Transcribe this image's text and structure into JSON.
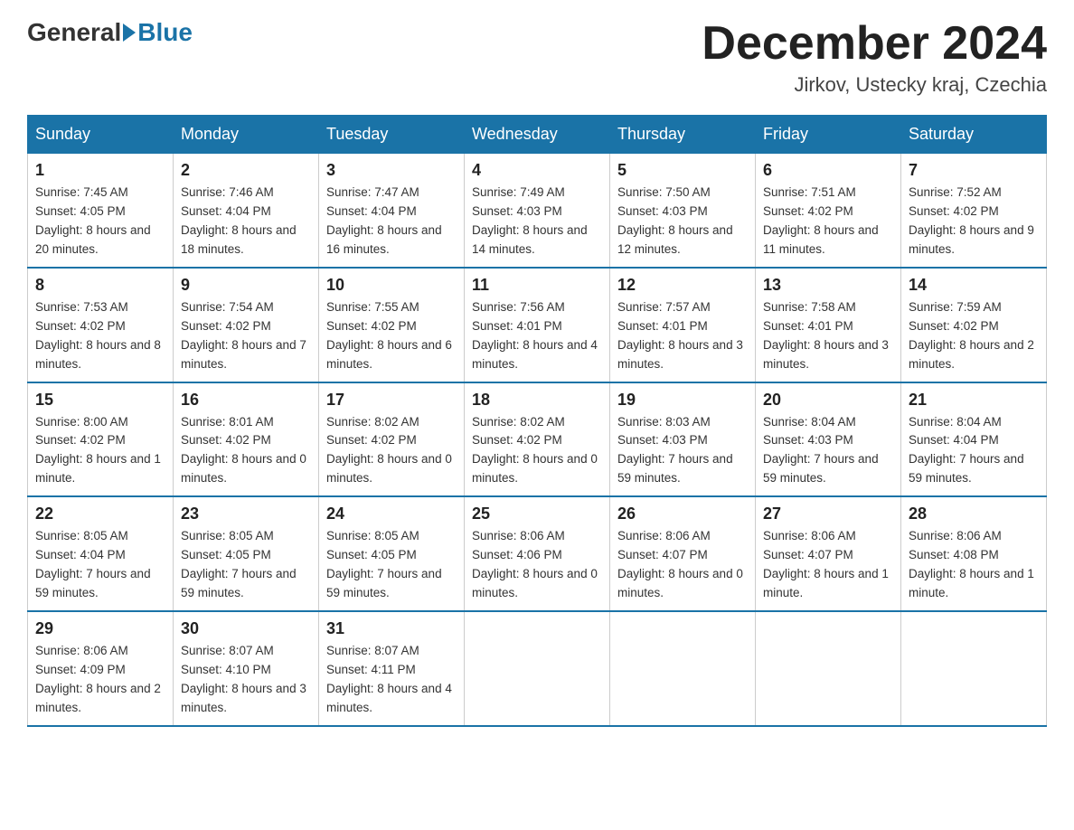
{
  "header": {
    "logo_general": "General",
    "logo_blue": "Blue",
    "title": "December 2024",
    "location": "Jirkov, Ustecky kraj, Czechia"
  },
  "weekdays": [
    "Sunday",
    "Monday",
    "Tuesday",
    "Wednesday",
    "Thursday",
    "Friday",
    "Saturday"
  ],
  "weeks": [
    [
      {
        "day": "1",
        "sunrise": "7:45 AM",
        "sunset": "4:05 PM",
        "daylight": "8 hours and 20 minutes."
      },
      {
        "day": "2",
        "sunrise": "7:46 AM",
        "sunset": "4:04 PM",
        "daylight": "8 hours and 18 minutes."
      },
      {
        "day": "3",
        "sunrise": "7:47 AM",
        "sunset": "4:04 PM",
        "daylight": "8 hours and 16 minutes."
      },
      {
        "day": "4",
        "sunrise": "7:49 AM",
        "sunset": "4:03 PM",
        "daylight": "8 hours and 14 minutes."
      },
      {
        "day": "5",
        "sunrise": "7:50 AM",
        "sunset": "4:03 PM",
        "daylight": "8 hours and 12 minutes."
      },
      {
        "day": "6",
        "sunrise": "7:51 AM",
        "sunset": "4:02 PM",
        "daylight": "8 hours and 11 minutes."
      },
      {
        "day": "7",
        "sunrise": "7:52 AM",
        "sunset": "4:02 PM",
        "daylight": "8 hours and 9 minutes."
      }
    ],
    [
      {
        "day": "8",
        "sunrise": "7:53 AM",
        "sunset": "4:02 PM",
        "daylight": "8 hours and 8 minutes."
      },
      {
        "day": "9",
        "sunrise": "7:54 AM",
        "sunset": "4:02 PM",
        "daylight": "8 hours and 7 minutes."
      },
      {
        "day": "10",
        "sunrise": "7:55 AM",
        "sunset": "4:02 PM",
        "daylight": "8 hours and 6 minutes."
      },
      {
        "day": "11",
        "sunrise": "7:56 AM",
        "sunset": "4:01 PM",
        "daylight": "8 hours and 4 minutes."
      },
      {
        "day": "12",
        "sunrise": "7:57 AM",
        "sunset": "4:01 PM",
        "daylight": "8 hours and 3 minutes."
      },
      {
        "day": "13",
        "sunrise": "7:58 AM",
        "sunset": "4:01 PM",
        "daylight": "8 hours and 3 minutes."
      },
      {
        "day": "14",
        "sunrise": "7:59 AM",
        "sunset": "4:02 PM",
        "daylight": "8 hours and 2 minutes."
      }
    ],
    [
      {
        "day": "15",
        "sunrise": "8:00 AM",
        "sunset": "4:02 PM",
        "daylight": "8 hours and 1 minute."
      },
      {
        "day": "16",
        "sunrise": "8:01 AM",
        "sunset": "4:02 PM",
        "daylight": "8 hours and 0 minutes."
      },
      {
        "day": "17",
        "sunrise": "8:02 AM",
        "sunset": "4:02 PM",
        "daylight": "8 hours and 0 minutes."
      },
      {
        "day": "18",
        "sunrise": "8:02 AM",
        "sunset": "4:02 PM",
        "daylight": "8 hours and 0 minutes."
      },
      {
        "day": "19",
        "sunrise": "8:03 AM",
        "sunset": "4:03 PM",
        "daylight": "7 hours and 59 minutes."
      },
      {
        "day": "20",
        "sunrise": "8:04 AM",
        "sunset": "4:03 PM",
        "daylight": "7 hours and 59 minutes."
      },
      {
        "day": "21",
        "sunrise": "8:04 AM",
        "sunset": "4:04 PM",
        "daylight": "7 hours and 59 minutes."
      }
    ],
    [
      {
        "day": "22",
        "sunrise": "8:05 AM",
        "sunset": "4:04 PM",
        "daylight": "7 hours and 59 minutes."
      },
      {
        "day": "23",
        "sunrise": "8:05 AM",
        "sunset": "4:05 PM",
        "daylight": "7 hours and 59 minutes."
      },
      {
        "day": "24",
        "sunrise": "8:05 AM",
        "sunset": "4:05 PM",
        "daylight": "7 hours and 59 minutes."
      },
      {
        "day": "25",
        "sunrise": "8:06 AM",
        "sunset": "4:06 PM",
        "daylight": "8 hours and 0 minutes."
      },
      {
        "day": "26",
        "sunrise": "8:06 AM",
        "sunset": "4:07 PM",
        "daylight": "8 hours and 0 minutes."
      },
      {
        "day": "27",
        "sunrise": "8:06 AM",
        "sunset": "4:07 PM",
        "daylight": "8 hours and 1 minute."
      },
      {
        "day": "28",
        "sunrise": "8:06 AM",
        "sunset": "4:08 PM",
        "daylight": "8 hours and 1 minute."
      }
    ],
    [
      {
        "day": "29",
        "sunrise": "8:06 AM",
        "sunset": "4:09 PM",
        "daylight": "8 hours and 2 minutes."
      },
      {
        "day": "30",
        "sunrise": "8:07 AM",
        "sunset": "4:10 PM",
        "daylight": "8 hours and 3 minutes."
      },
      {
        "day": "31",
        "sunrise": "8:07 AM",
        "sunset": "4:11 PM",
        "daylight": "8 hours and 4 minutes."
      },
      null,
      null,
      null,
      null
    ]
  ]
}
